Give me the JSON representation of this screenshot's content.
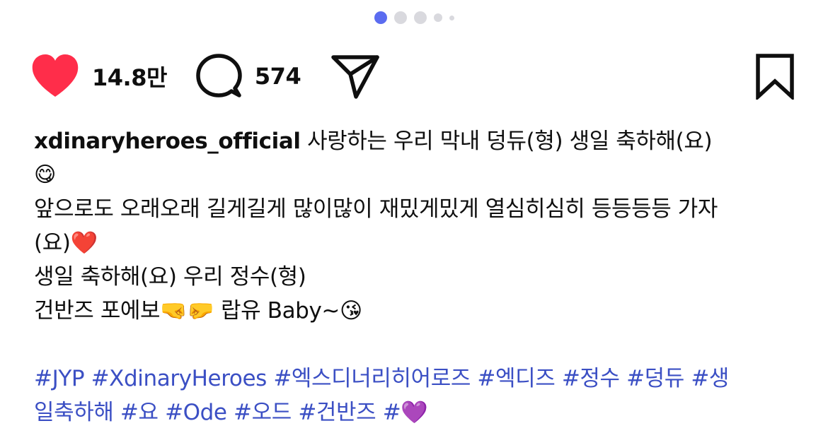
{
  "carousel": {
    "count": 5,
    "active_index": 0,
    "accent_color": "#5b6cf0"
  },
  "actions": {
    "likes_count": "14.8만",
    "comments_count": "574",
    "like_color": "#ff2d4a"
  },
  "caption": {
    "username": "xdinaryheroes_official",
    "line1_text": " 사랑하는 우리 막내 덩듀(형) 생일 축하해(요)",
    "line2_text": "😋",
    "line3_text": "앞으로도 오래오래 길게길게 많이많이 재밌게밌게 열심히심히 등등등등 가자",
    "line4_text": "(요)❤️",
    "line5_text": "생일 축하해(요) 우리 정수(형)",
    "line6_text": "건반즈 포에보🤜🤛 랍유 Baby~😘",
    "hashtags_line1": "#JYP #XdinaryHeroes #엑스디너리히어로즈 #엑디즈 #정수 #덩듀 #생",
    "hashtags_line2": "일축하해 #요 #Ode #오드 #건반즈 #💜",
    "hashtag_color": "#3b4fc4"
  }
}
